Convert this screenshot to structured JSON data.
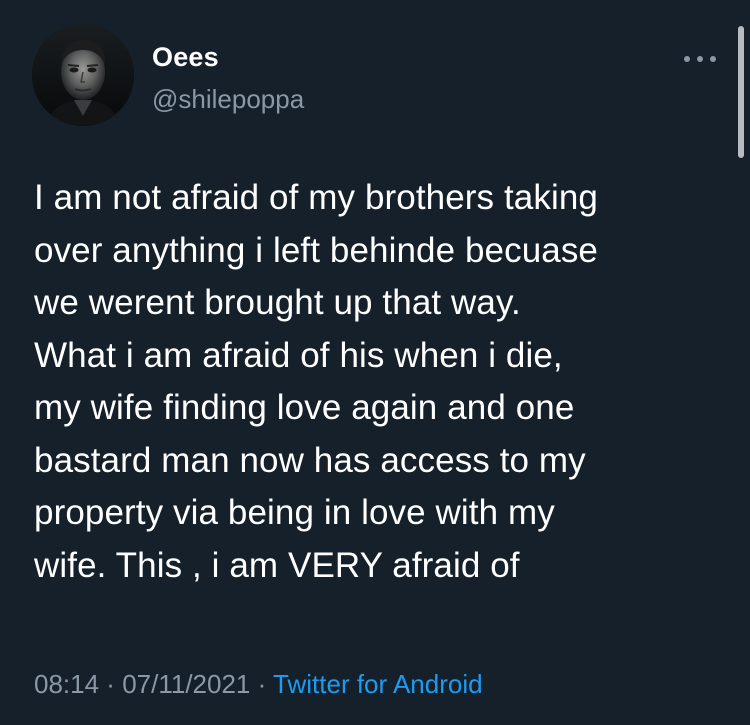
{
  "author": {
    "display_name": "Oees",
    "handle": "@shilepoppa"
  },
  "tweet": {
    "text": "I am not afraid of my brothers taking\nover anything i left behinde becuase\nwe werent brought up that way.\nWhat i am afraid of his when i die,\nmy wife finding love again and one\nbastard man now has access to my\nproperty via being in love with my\nwife. This , i am VERY afraid of",
    "time": "08:14",
    "separator": " · ",
    "date": "07/11/2021",
    "source": "Twitter for Android"
  },
  "icons": {
    "avatar": "profile-photo",
    "more": "more-horizontal-icon"
  },
  "colors": {
    "background": "#15202b",
    "text": "#ffffff",
    "secondary_text": "#8b98a5",
    "link": "#1d9bf0"
  }
}
